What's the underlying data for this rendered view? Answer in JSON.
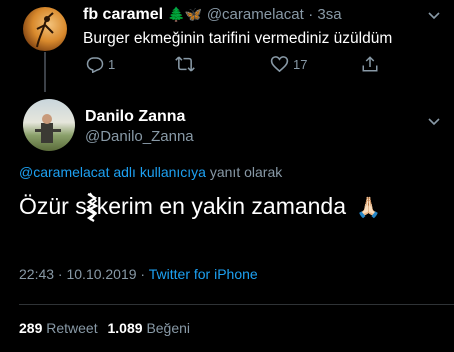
{
  "tweet1": {
    "display_name": "fb caramel",
    "emojis": "🌲🦋",
    "handle": "@caramelacat",
    "time": "· 3sa",
    "text": "Burger ekmeğinin tarifini vermediniz üzüldüm",
    "reply_count": "1",
    "like_count": "17"
  },
  "tweet2": {
    "display_name": "Danilo Zanna",
    "handle": "@Danilo_Zanna",
    "reply_to_mention": "@caramelacat adlı kullanıcıya",
    "reply_to_suffix": "yanıt olarak",
    "text_before": "Özür s",
    "text_after": "kerim en yakin zamanda",
    "emoji": "🙏🏻",
    "time": "22:43 · 10.10.2019 ·",
    "source": "Twitter for iPhone",
    "retweet_count": "289",
    "retweet_label": "Retweet",
    "like_count": "1.089",
    "like_label": "Beğeni"
  },
  "colors": {
    "background": "#000000",
    "muted": "#8899a6",
    "link": "#1da1f2"
  }
}
